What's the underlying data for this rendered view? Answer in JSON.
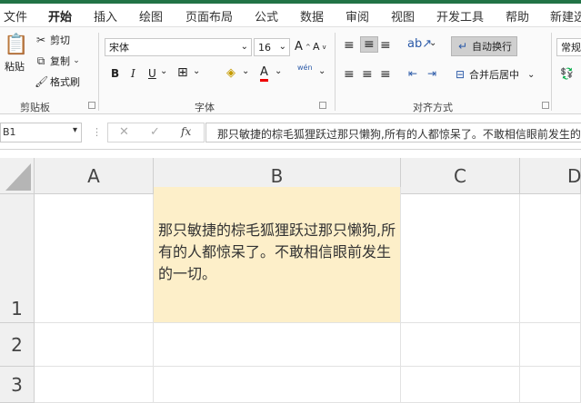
{
  "tabs": [
    "文件",
    "开始",
    "插入",
    "绘图",
    "页面布局",
    "公式",
    "数据",
    "审阅",
    "视图",
    "开发工具",
    "帮助",
    "新建选"
  ],
  "ribbon": {
    "clipboard": {
      "paste": "粘贴",
      "cut": "剪切",
      "copy": "复制",
      "format_painter": "格式刷",
      "label": "剪贴板"
    },
    "font": {
      "name": "宋体",
      "size": "16",
      "grow": "A",
      "shrink": "A",
      "bold": "B",
      "italic": "I",
      "underline": "U",
      "font_color": "A",
      "phonetic": "wén",
      "label": "字体"
    },
    "alignment": {
      "wrap_text": "自动换行",
      "merge_center": "合并后居中",
      "label": "对齐方式"
    },
    "number": {
      "format": "常规"
    }
  },
  "formula_bar": {
    "name_box": "B1",
    "cancel": "✕",
    "enter": "✓",
    "fx": "fx",
    "content": "那只敏捷的棕毛狐狸跃过那只懒狗,所有的人都惊呆了。不敢相信眼前发生的一切。"
  },
  "sheet": {
    "columns": [
      "A",
      "B",
      "C",
      "D"
    ],
    "rows": [
      "1",
      "2",
      "3"
    ],
    "cell_b1": "那只敏捷的棕毛狐狸跃过那只懒狗,所有的人都惊呆了。不敢相信眼前发生的一切。",
    "cell_b1_fill": "#fdefc9",
    "accent": "#217346"
  }
}
